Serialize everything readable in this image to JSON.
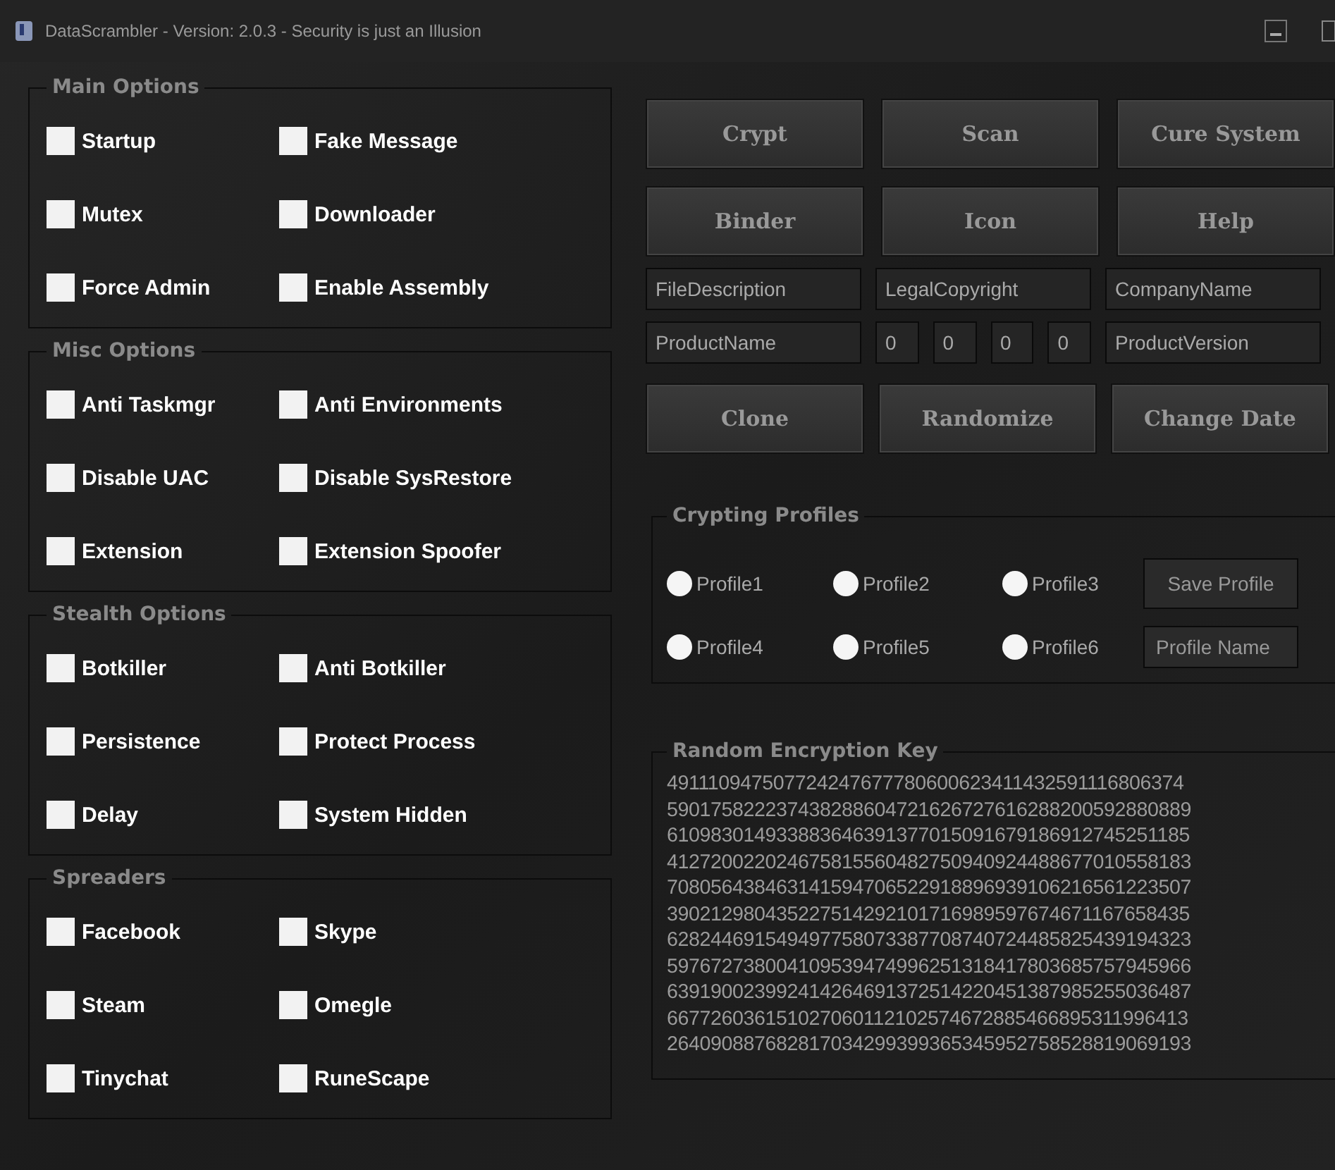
{
  "window": {
    "title": "DataScrambler - Version: 2.0.3 - Security is just an Illusion"
  },
  "option_groups": [
    {
      "title": "Main Options",
      "options": [
        {
          "label": "Startup",
          "checked": false
        },
        {
          "label": "Fake Message",
          "checked": false
        },
        {
          "label": "Mutex",
          "checked": false
        },
        {
          "label": "Downloader",
          "checked": false
        },
        {
          "label": "Force Admin",
          "checked": false
        },
        {
          "label": "Enable Assembly",
          "checked": false
        }
      ]
    },
    {
      "title": "Misc Options",
      "options": [
        {
          "label": "Anti Taskmgr",
          "checked": false
        },
        {
          "label": "Anti Environments",
          "checked": false
        },
        {
          "label": "Disable UAC",
          "checked": false
        },
        {
          "label": "Disable SysRestore",
          "checked": false
        },
        {
          "label": "Extension",
          "checked": false
        },
        {
          "label": "Extension Spoofer",
          "checked": false
        }
      ]
    },
    {
      "title": "Stealth Options",
      "options": [
        {
          "label": "Botkiller",
          "checked": false
        },
        {
          "label": "Anti Botkiller",
          "checked": false
        },
        {
          "label": "Persistence",
          "checked": false
        },
        {
          "label": "Protect Process",
          "checked": false
        },
        {
          "label": "Delay",
          "checked": false
        },
        {
          "label": "System Hidden",
          "checked": false
        }
      ]
    },
    {
      "title": "Spreaders",
      "options": [
        {
          "label": "Facebook",
          "checked": false
        },
        {
          "label": "Skype",
          "checked": false
        },
        {
          "label": "Steam",
          "checked": false
        },
        {
          "label": "Omegle",
          "checked": false
        },
        {
          "label": "Tinychat",
          "checked": false
        },
        {
          "label": "RuneScape",
          "checked": false
        }
      ]
    }
  ],
  "action_buttons": [
    "Crypt",
    "Scan",
    "Cure System",
    "Binder",
    "Icon",
    "Help"
  ],
  "fields_row_1": [
    "FileDescription",
    "LegalCopyright",
    "CompanyName"
  ],
  "fields_row_2": {
    "product_name": "ProductName",
    "version_parts": [
      "0",
      "0",
      "0",
      "0"
    ],
    "product_version": "ProductVersion"
  },
  "tool_buttons": [
    "Clone",
    "Randomize",
    "Change Date"
  ],
  "crypting_profiles": {
    "title": "Crypting Profiles",
    "profiles": [
      {
        "label": "Profile1",
        "selected": false
      },
      {
        "label": "Profile2",
        "selected": false
      },
      {
        "label": "Profile3",
        "selected": false
      },
      {
        "label": "Profile4",
        "selected": false
      },
      {
        "label": "Profile5",
        "selected": false
      },
      {
        "label": "Profile6",
        "selected": false
      }
    ],
    "save_button": "Save Profile",
    "name_field": "Profile Name"
  },
  "encryption_key": {
    "title": "Random Encryption Key",
    "lines": [
      "491110947507724247677780600623411432591116806374",
      "590175822237438288604721626727616288200592880889",
      "610983014933883646391377015091679186912745251185",
      "412720022024675815560482750940924488677010558183",
      "708056438463141594706522918896939106216561223507",
      "390212980435227514292101716989597674671167658435",
      "628244691549497758073387708740724485825439194323",
      "597672738004109539474996251318417803685757945966",
      "639190023992414264691372514220451387985255036487",
      "667726036151027060112102574672885466895311996413",
      "264090887682817034299399365345952758528819069193"
    ]
  }
}
